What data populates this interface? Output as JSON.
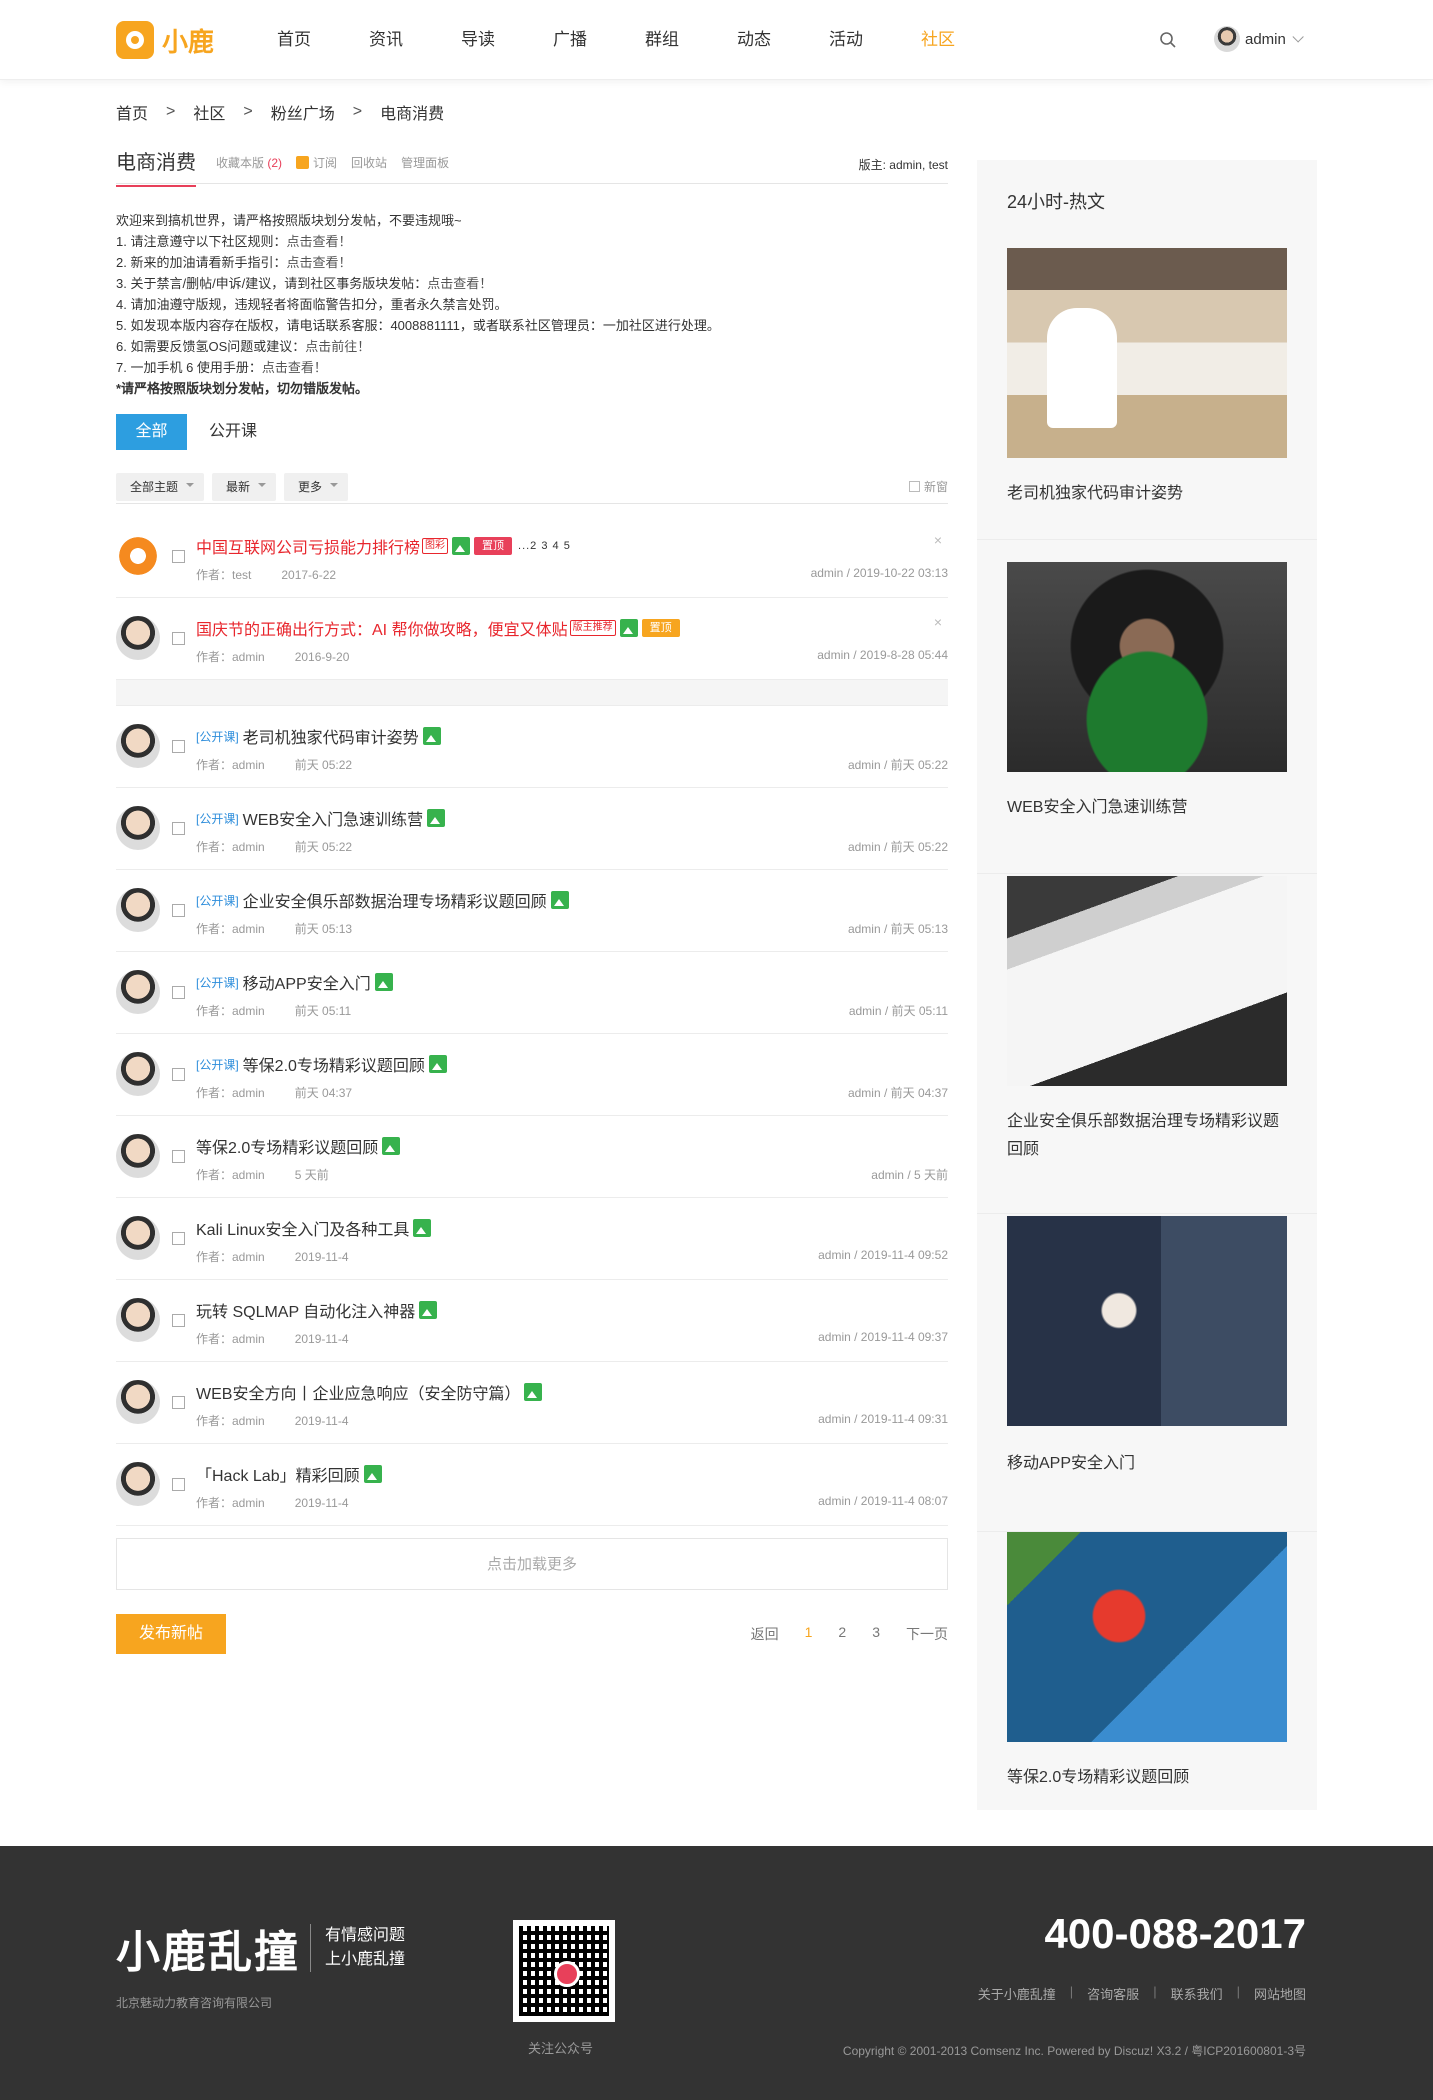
{
  "header": {
    "logo_text": "小鹿",
    "nav": [
      "首页",
      "资讯",
      "导读",
      "广播",
      "群组",
      "动态",
      "活动",
      "社区"
    ],
    "active_nav": "社区",
    "user": "admin",
    "accent": "#f7a51f"
  },
  "breadcrumb": [
    "首页",
    "社区",
    "粉丝广场",
    "电商消费"
  ],
  "breadcrumb_sep": ">",
  "forum": {
    "title": "电商消费",
    "fav_label": "收藏本版",
    "fav_count": "(2)",
    "subscribe": "订阅",
    "recycle": "回收站",
    "admin_panel": "管理面板",
    "moderators": "版主: admin, test"
  },
  "rules": [
    {
      "text": "欢迎来到搞机世界，请严格按照版块划分发帖，不要违规哦~",
      "link": ""
    },
    {
      "text": "1. 请注意遵守以下社区规则：",
      "link": "点击查看！"
    },
    {
      "text": "2. 新来的加油请看新手指引：",
      "link": "点击查看！"
    },
    {
      "text": "3. 关于禁言/删帖/申诉/建议，请到社区事务版块发帖：",
      "link": "点击查看！"
    },
    {
      "text": "4. 请加油遵守版规，违规轻者将面临警告扣分，重者永久禁言处罚。",
      "link": ""
    },
    {
      "text": "5. 如发现本版内容存在版权，请电话联系客服：4008881111，或者联系社区管理员：一加社区进行处理。",
      "link": ""
    },
    {
      "text": "6. 如需要反馈氢OS问题或建议：",
      "link": "点击前往！"
    },
    {
      "text": "7. 一加手机 6 使用手册：",
      "link": "点击查看！"
    }
  ],
  "rules_bold": "*请严格按照版块划分发帖，切勿错版发帖。",
  "tabs": [
    "全部",
    "公开课"
  ],
  "filters": [
    "全部主题",
    "最新",
    "更多"
  ],
  "new_window": "新窗",
  "sticky": [
    {
      "title": "中国互联网公司亏损能力排行榜",
      "badge": "图彩",
      "tag": "置顶",
      "pages": "...2 3 4 5",
      "author": "作者：test",
      "date": "2017-6-22",
      "last": "admin / 2019-10-22 03:13"
    },
    {
      "title": "国庆节的正确出行方式：AI 帮你做攻略，便宜又体贴",
      "badge": "版主推荐",
      "tag": "置顶",
      "author": "作者：admin",
      "date": "2016-9-20",
      "last": "admin / 2019-8-28 05:44"
    }
  ],
  "threads": [
    {
      "type": "[公开课]",
      "title": "老司机独家代码审计姿势",
      "author": "作者：admin",
      "date": "前天 05:22",
      "last": "admin / 前天 05:22"
    },
    {
      "type": "[公开课]",
      "title": "WEB安全入门急速训练营",
      "author": "作者：admin",
      "date": "前天 05:22",
      "last": "admin / 前天 05:22"
    },
    {
      "type": "[公开课]",
      "title": "企业安全俱乐部数据治理专场精彩议题回顾",
      "author": "作者：admin",
      "date": "前天 05:13",
      "last": "admin / 前天 05:13"
    },
    {
      "type": "[公开课]",
      "title": "移动APP安全入门",
      "author": "作者：admin",
      "date": "前天 05:11",
      "last": "admin / 前天 05:11"
    },
    {
      "type": "[公开课]",
      "title": "等保2.0专场精彩议题回顾",
      "author": "作者：admin",
      "date": "前天 04:37",
      "last": "admin / 前天 04:37"
    },
    {
      "type": "",
      "title": "等保2.0专场精彩议题回顾",
      "author": "作者：admin",
      "date": "5 天前",
      "last": "admin / 5 天前"
    },
    {
      "type": "",
      "title": "Kali Linux安全入门及各种工具",
      "author": "作者：admin",
      "date": "2019-11-4",
      "last": "admin / 2019-11-4 09:52"
    },
    {
      "type": "",
      "title": "玩转 SQLMAP 自动化注入神器",
      "author": "作者：admin",
      "date": "2019-11-4",
      "last": "admin / 2019-11-4 09:37"
    },
    {
      "type": "",
      "title": "WEB安全方向丨企业应急响应（安全防守篇）",
      "author": "作者：admin",
      "date": "2019-11-4",
      "last": "admin / 2019-11-4 09:31"
    },
    {
      "type": "",
      "title": "「Hack Lab」精彩回顾",
      "author": "作者：admin",
      "date": "2019-11-4",
      "last": "admin / 2019-11-4 08:07"
    }
  ],
  "load_more": "点击加载更多",
  "post_button": "发布新帖",
  "pager": {
    "back": "返回",
    "pages": [
      "1",
      "2",
      "3"
    ],
    "current": "1",
    "next": "下一页"
  },
  "sidebar": {
    "title": "24小时-热文",
    "items": [
      "老司机独家代码审计姿势",
      "WEB安全入门急速训练营",
      "企业安全俱乐部数据治理专场精彩议题回顾",
      "移动APP安全入门",
      "等保2.0专场精彩议题回顾"
    ]
  },
  "footer": {
    "brand": "小鹿乱撞",
    "slogan1": "有情感问题",
    "slogan2": "上小鹿乱撞",
    "company": "北京魅动力教育咨询有限公司",
    "qr_label": "关注公众号",
    "phone": "400-088-2017",
    "links": [
      "关于小鹿乱撞",
      "咨询客服",
      "联系我们",
      "网站地图"
    ],
    "copyright": "Copyright © 2001-2013 Comsenz Inc. Powered by Discuz! X3.2 / 粤ICP201600801-3号"
  }
}
